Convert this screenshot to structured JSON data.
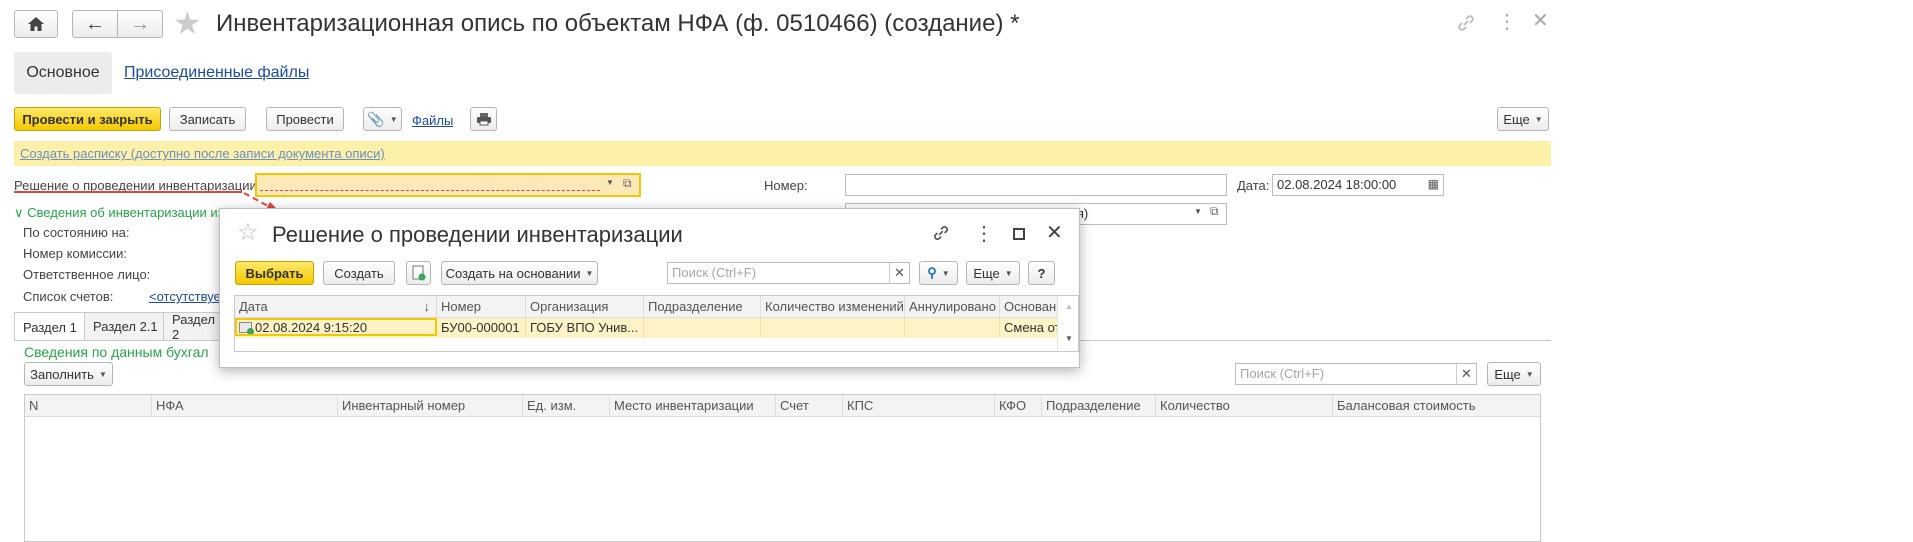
{
  "window": {
    "title": "Инвентаризационная опись по объектам НФА (ф. 0510466) (создание) *"
  },
  "nav_tabs": {
    "main": "Основное",
    "files": "Присоединенные файлы"
  },
  "toolbar": {
    "post_close": "Провести и закрыть",
    "save": "Записать",
    "post": "Провести",
    "files": "Файлы",
    "more": "Еще"
  },
  "info_bar": {
    "link": "Создать расписку (доступно после записи документа описи)"
  },
  "form": {
    "decision_label": "Решение о проведении инвентаризации:",
    "number_label": "Номер:",
    "date_label": "Дата:",
    "date_value": "02.08.2024 18:00:00",
    "org_partial": "дия)",
    "info_section": "Сведения об инвентаризации из",
    "as_of_label": "По состоянию на:",
    "commission_label": "Номер комиссии:",
    "responsible_label": "Ответственное лицо:",
    "accounts_label": "Список счетов:",
    "accounts_value": "<отсутствуе"
  },
  "sections": {
    "tabs": [
      "Раздел 1",
      "Раздел 2.1",
      "Раздел 2"
    ],
    "heading": "Сведения по данным бухгал",
    "fill_button": "Заполнить",
    "search_placeholder": "Поиск (Ctrl+F)",
    "more": "Еще",
    "columns": [
      "N",
      "НФА",
      "Инвентарный номер",
      "Ед. изм.",
      "Место инвентаризации",
      "Счет",
      "КПС",
      "КФО",
      "Подразделение",
      "Количество",
      "Балансовая стоимость"
    ]
  },
  "dialog": {
    "title": "Решение о проведении инвентаризации",
    "select_button": "Выбрать",
    "create_button": "Создать",
    "create_based_button": "Создать на основании",
    "search_placeholder": "Поиск (Ctrl+F)",
    "more": "Еще",
    "help": "?",
    "columns": [
      "Дата",
      "Номер",
      "Организация",
      "Подразделение",
      "Количество изменений",
      "Аннулировано",
      "Основани"
    ],
    "rows": [
      {
        "date": "02.08.2024 9:15:20",
        "number": "БУ00-000001",
        "org": "ГОБУ ВПО Унив...",
        "dept": "",
        "changes": "",
        "cancelled": "",
        "basis": "Смена отв"
      }
    ]
  },
  "colors": {
    "accent_yellow": "#f4c800",
    "link_blue": "#1d4b9b",
    "green": "#26a44a",
    "info_bar_bg": "#fdf0a8",
    "selected_row": "#fdf3c6",
    "arrow_red": "#e4453c"
  }
}
